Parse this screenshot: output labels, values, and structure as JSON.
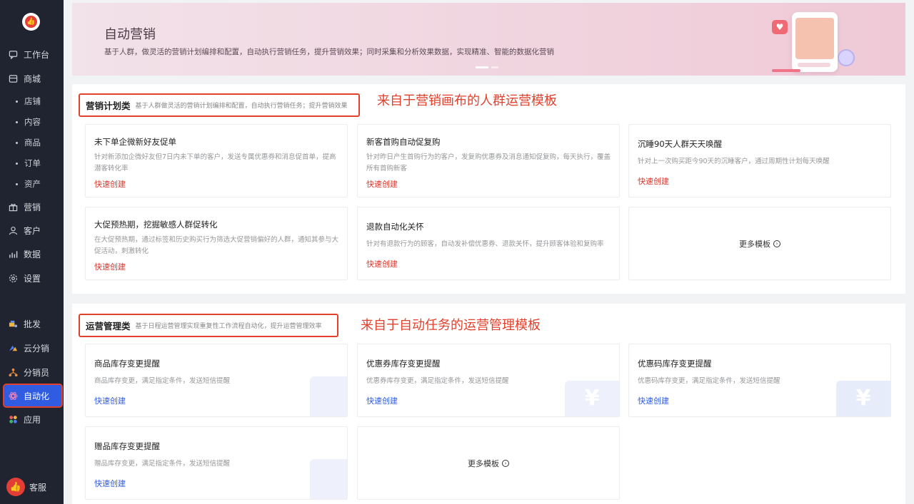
{
  "sidebar": {
    "logo_glyph": "👍",
    "items": [
      {
        "label": "工作台",
        "icon": "chat-icon"
      },
      {
        "label": "商城",
        "icon": "store-icon"
      },
      {
        "label": "营销",
        "icon": "gift-icon"
      },
      {
        "label": "客户",
        "icon": "user-icon"
      },
      {
        "label": "数据",
        "icon": "chart-icon"
      },
      {
        "label": "设置",
        "icon": "gear-icon"
      },
      {
        "label": "批发",
        "icon": "wholesale-icon"
      },
      {
        "label": "云分销",
        "icon": "cloud-distribution-icon"
      },
      {
        "label": "分销员",
        "icon": "distributor-icon"
      },
      {
        "label": "自动化",
        "icon": "automation-icon"
      },
      {
        "label": "应用",
        "icon": "apps-icon"
      }
    ],
    "sub_items": [
      "店铺",
      "内容",
      "商品",
      "订单",
      "资产"
    ],
    "support_label": "客服",
    "support_glyph": "👍"
  },
  "banner": {
    "title": "自动营销",
    "description": "基于人群，做灵活的营销计划编排和配置，自动执行营销任务，提升营销效果；同时采集和分析效果数据，实现精准、智能的数据化营销",
    "heart_glyph": "♥"
  },
  "marketing_section": {
    "title": "营销计划类",
    "description": "基于人群做灵活的营销计划编排和配置，自动执行营销任务；提升营销效果",
    "annotation": "来自于营销画布的人群运营模板",
    "cards": [
      {
        "title": "未下单企微新好友促单",
        "desc": "针对新添加企微好友但7日内未下单的客户，发送专属优惠券和消息促首单，提高潜客转化率",
        "link": "快速创建"
      },
      {
        "title": "新客首购自动促复购",
        "desc": "针对昨日产生首购行为的客户，发复购优惠券及消息通知促复购，每天执行，覆盖所有首购新客",
        "link": "快速创建"
      },
      {
        "title": "沉睡90天人群天天唤醒",
        "desc": "针对上一次购买距今90天的沉睡客户，通过周期性计划每天唤醒",
        "link": "快速创建"
      },
      {
        "title": "大促预热期，挖掘敏感人群促转化",
        "desc": "在大促预热期，通过标签和历史购买行为筛选大促营销偏好的人群，通知其参与大促活动，刺激转化",
        "link": "快速创建"
      },
      {
        "title": "退款自动化关怀",
        "desc": "针对有退款行为的顾客，自动发补偿优惠券、退款关怀，提升顾客体验和复购率",
        "link": "快速创建"
      }
    ],
    "more_label": "更多模板",
    "more_arrow": "›"
  },
  "ops_section": {
    "title": "运营管理类",
    "description": "基于日程运营管理实现重复性工作流程自动化，提升运营管理效率",
    "annotation": "来自于自动任务的运营管理模板",
    "cards": [
      {
        "title": "商品库存变更提醒",
        "desc": "商品库存变更，满足指定条件，发送短信提醒",
        "link": "快速创建"
      },
      {
        "title": "优惠券库存变更提醒",
        "desc": "优惠券库存变更，满足指定条件，发送短信提醒",
        "link": "快速创建"
      },
      {
        "title": "优惠码库存变更提醒",
        "desc": "优惠码库存变更，满足指定条件，发送短信提醒",
        "link": "快速创建"
      },
      {
        "title": "赠品库存变更提醒",
        "desc": "赠品库存变更，满足指定条件，发送短信提醒",
        "link": "快速创建"
      }
    ],
    "deco_yen": "¥",
    "more_label": "更多模板",
    "more_arrow": "›"
  },
  "colors": {
    "sidebar_bg": "#1f2430",
    "active": "#2f5ce0",
    "annotation_red": "#e0412c",
    "link_red": "#d8382e",
    "link_blue": "#2f5ce0"
  }
}
